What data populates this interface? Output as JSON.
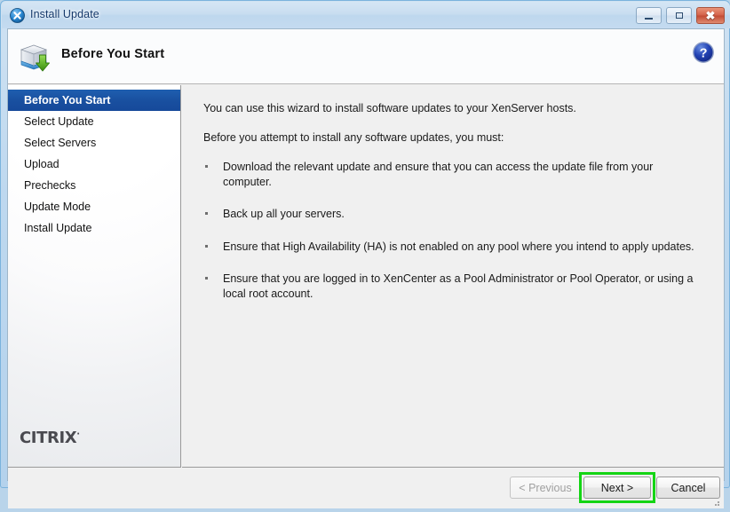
{
  "window": {
    "title": "Install Update",
    "app_icon": "xencenter-close-circle-icon",
    "controls": {
      "minimize": "Minimize",
      "maximize": "Maximize",
      "close": "Close"
    }
  },
  "header": {
    "title": "Before You Start",
    "icon": "update-package-download-icon",
    "help_label": "?"
  },
  "sidebar": {
    "items": [
      {
        "label": "Before You Start",
        "selected": true
      },
      {
        "label": "Select Update",
        "selected": false
      },
      {
        "label": "Select Servers",
        "selected": false
      },
      {
        "label": "Upload",
        "selected": false
      },
      {
        "label": "Prechecks",
        "selected": false
      },
      {
        "label": "Update Mode",
        "selected": false
      },
      {
        "label": "Install Update",
        "selected": false
      }
    ],
    "logo_text": "CITRIX"
  },
  "content": {
    "intro": "You can use this wizard to install software updates to your XenServer hosts.",
    "prerequisite_intro": "Before you attempt to install any software updates, you must:",
    "bullets": [
      "Download the relevant update and ensure that you can access the update file from your computer.",
      "Back up all your servers.",
      "Ensure that High Availability (HA) is not enabled on any pool where you intend to apply updates.",
      "Ensure that you are logged in to XenCenter as a Pool Administrator or Pool Operator, or using a local root account."
    ]
  },
  "buttons": {
    "previous": "< Previous",
    "next": "Next >",
    "cancel": "Cancel"
  },
  "colors": {
    "selection_blue": "#1950a0",
    "highlight_green": "#14d514",
    "titlebar_blue": "#c8ddf0",
    "help_blue": "#1f3f9e"
  }
}
